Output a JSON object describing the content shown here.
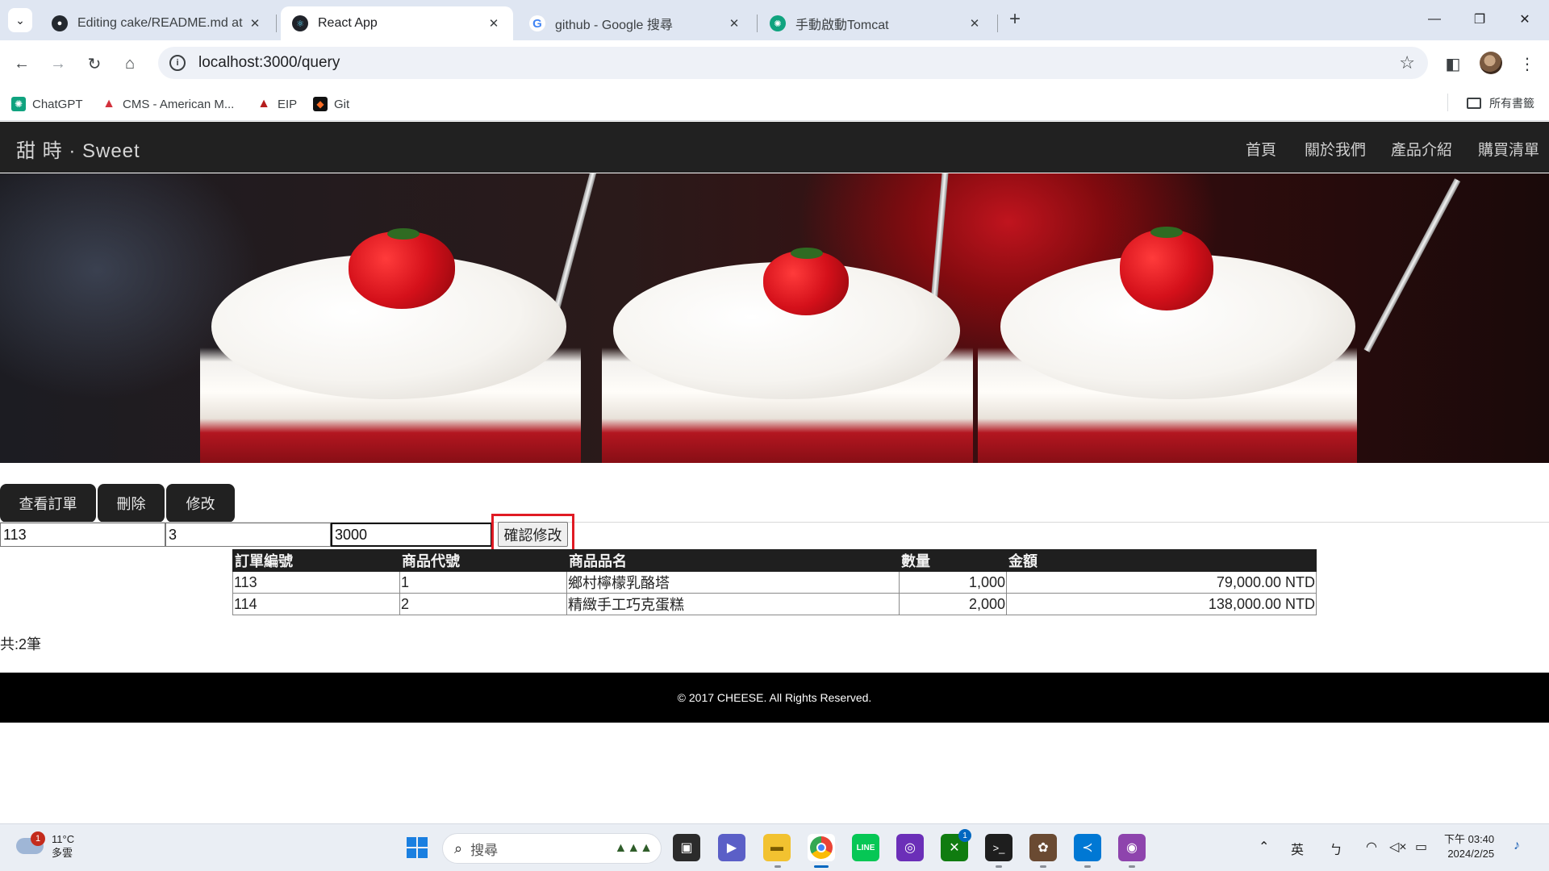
{
  "browser": {
    "tabs": [
      {
        "title": "Editing cake/README.md at m",
        "icon": "github-icon",
        "active": false
      },
      {
        "title": "React App",
        "icon": "react-icon",
        "active": true
      },
      {
        "title": "github - Google 搜尋",
        "icon": "google-icon",
        "active": false
      },
      {
        "title": "手動啟動Tomcat",
        "icon": "chatgpt-icon",
        "active": false
      }
    ],
    "url": "localhost:3000/query",
    "bookmarks": [
      {
        "label": "ChatGPT",
        "icon": "chatgpt-icon"
      },
      {
        "label": "CMS - American M...",
        "icon": "cms-icon"
      },
      {
        "label": "EIP",
        "icon": "eip-icon"
      },
      {
        "label": "Git",
        "icon": "gitlab-icon"
      }
    ],
    "all_bookmarks": "所有書籤"
  },
  "site": {
    "brand": "甜 時 · Sweet",
    "nav": [
      "首頁",
      "關於我們",
      "產品介紹",
      "購買清單"
    ],
    "buttons": {
      "view_orders": "查看訂單",
      "delete": "刪除",
      "edit": "修改"
    },
    "edit_form": {
      "order_id": "113",
      "product_code": "3",
      "amount": "3000",
      "confirm": "確認修改"
    },
    "table": {
      "headers": [
        "訂單編號",
        "商品代號",
        "商品品名",
        "數量",
        "金額"
      ],
      "rows": [
        [
          "113",
          "1",
          "鄉村檸檬乳酪塔",
          "1,000",
          "79,000.00 NTD"
        ],
        [
          "114",
          "2",
          "精緻手工巧克蛋糕",
          "2,000",
          "138,000.00 NTD"
        ]
      ]
    },
    "count_text": "共:2筆",
    "footer": "© 2017 CHEESE. All Rights Reserved."
  },
  "taskbar": {
    "weather": {
      "temp": "11°C",
      "condition": "多雲",
      "badge": "1"
    },
    "search_placeholder": "搜尋",
    "ime": "英",
    "ime_mode": "ㄅ",
    "clock": {
      "time": "下午 03:40",
      "date": "2024/2/25"
    },
    "xbox_badge": "1"
  },
  "colors": {
    "nav_bg": "#212121",
    "highlight": "#e01b24",
    "taskbar_accent": "#0067c0"
  }
}
